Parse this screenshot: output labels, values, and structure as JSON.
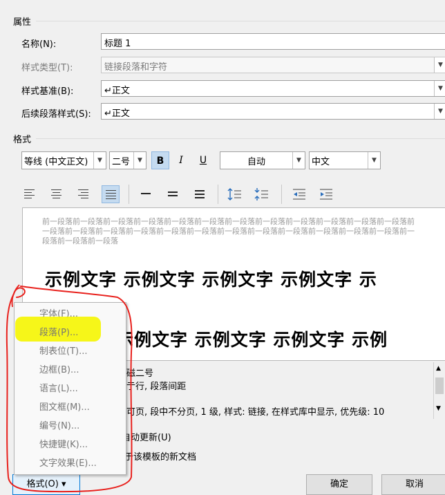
{
  "properties": {
    "section_title": "属性",
    "name_label": "名称(N):",
    "name_value": "标题 1",
    "style_type_label": "样式类型(T):",
    "style_type_value": "链接段落和字符",
    "style_based_label": "样式基准(B):",
    "style_based_value": "↵正文",
    "next_style_label": "后续段落样式(S):",
    "next_style_value": "↵正文"
  },
  "format": {
    "section_title": "格式",
    "font_value": "等线 (中文正文)",
    "size_value": "二号",
    "bold_label": "B",
    "italic_label": "I",
    "underline_label": "U",
    "color_value": "自动",
    "script_value": "中文"
  },
  "preview": {
    "previous_paragraph_text": "前一段落前一段落前一段落前一段落前一段落前一段落前一段落前一段落前一段落前一段落前一段落前一段落前一段落前一段落前一段落前一段落前一段落前一段落前一段落前一段落前一段落前一段落前一段落前一段落前一段落前一段落前一段落",
    "sample_line1": "示例文字 示例文字 示例文字 示例文字 示",
    "sample_line2": "示例文字 示例文字 示例文字 示例"
  },
  "description": {
    "line1": "磁二号",
    "line2": "亍行, 段落间距",
    "line3": "可页, 段中不分页, 1 级, 样式: 链接, 在样式库中显示, 优先级: 10"
  },
  "options": {
    "auto_update": "自动更新(U)",
    "template_docs": "于该模板的新文档"
  },
  "menu": {
    "items": [
      "字体(F)...",
      "段落(P)...",
      "制表位(T)...",
      "边框(B)...",
      "语言(L)...",
      "图文框(M)...",
      "编号(N)...",
      "快捷键(K)...",
      "文字效果(E)..."
    ]
  },
  "buttons": {
    "format": "格式(O) ▾",
    "ok": "确定",
    "cancel": "取消"
  },
  "colors": {
    "highlight": "#f5f500",
    "annotation": "#e8201c",
    "active_button": "#c5dbf0"
  },
  "icons": {
    "align": [
      "align-left-icon",
      "align-center-icon",
      "align-right-icon",
      "justify-icon"
    ],
    "spacing": [
      "single-spacing-icon",
      "one-half-spacing-icon",
      "double-spacing-icon"
    ],
    "paragraph": [
      "increase-paragraph-spacing-icon",
      "decrease-paragraph-spacing-icon",
      "decrease-indent-icon",
      "increase-indent-icon"
    ]
  }
}
